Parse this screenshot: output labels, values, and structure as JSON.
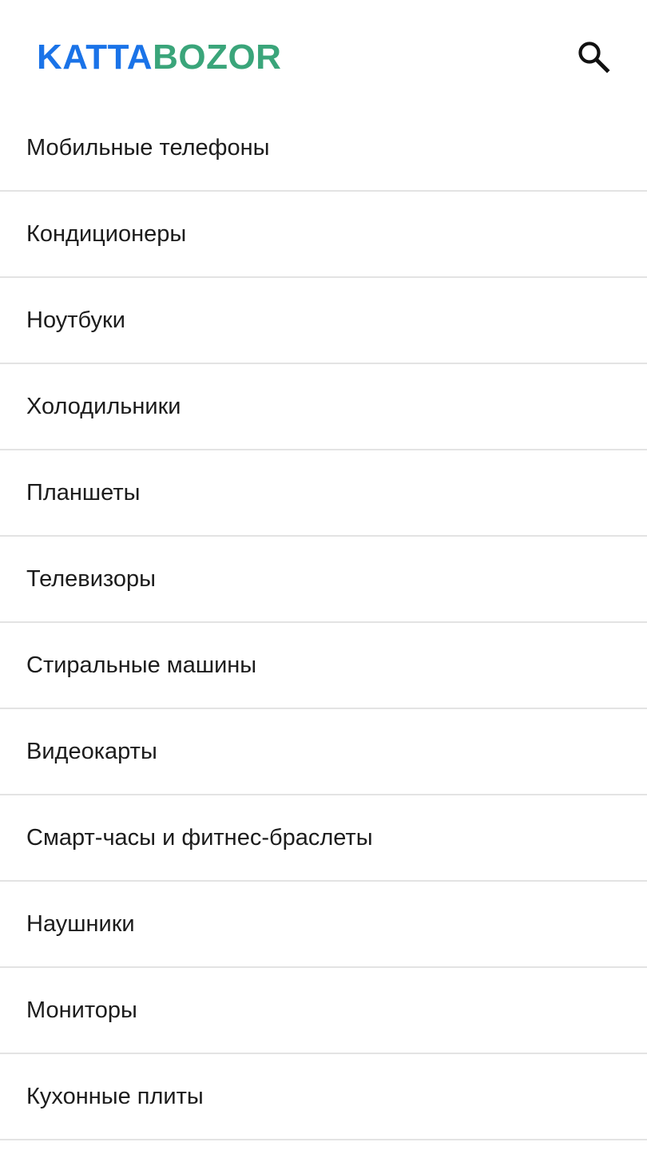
{
  "header": {
    "logo_part_1": "KATTA",
    "logo_part_2": "BOZOR",
    "logo_colors": {
      "part_1": "#1a73e8",
      "part_2": "#3aa57a"
    },
    "search_icon": "search-icon"
  },
  "categories": [
    {
      "label": "Мобильные телефоны"
    },
    {
      "label": "Кондиционеры"
    },
    {
      "label": "Ноутбуки"
    },
    {
      "label": "Холодильники"
    },
    {
      "label": "Планшеты"
    },
    {
      "label": "Телевизоры"
    },
    {
      "label": "Стиральные машины"
    },
    {
      "label": "Видеокарты"
    },
    {
      "label": "Смарт-часы и фитнес-браслеты"
    },
    {
      "label": "Наушники"
    },
    {
      "label": "Мониторы"
    },
    {
      "label": "Кухонные плиты"
    }
  ]
}
